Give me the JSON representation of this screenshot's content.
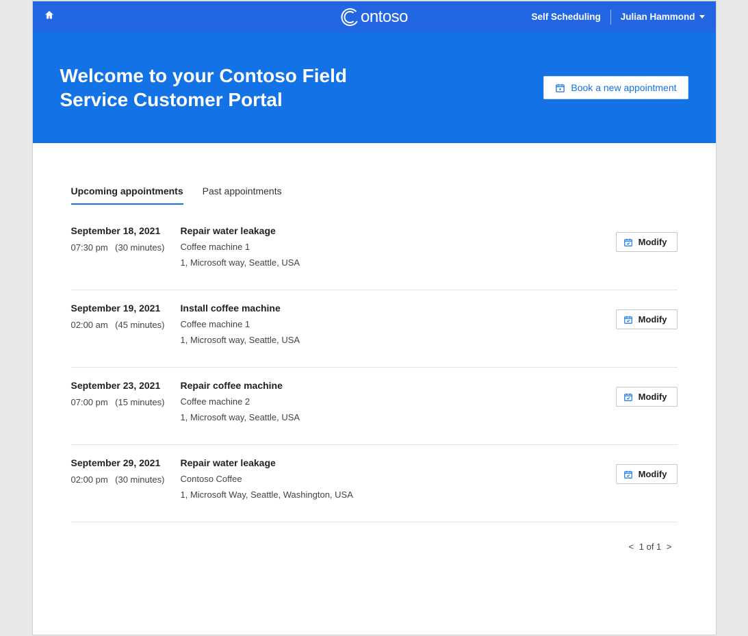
{
  "nav": {
    "brand": "ontoso",
    "self_scheduling": "Self Scheduling",
    "user_name": "Julian Hammond"
  },
  "hero": {
    "title": "Welcome to your Contoso Field Service Customer Portal",
    "book_label": "Book a new appointment"
  },
  "tabs": {
    "upcoming": "Upcoming appointments",
    "past": "Past appointments"
  },
  "appointments": [
    {
      "date": "September 18, 2021",
      "time": "07:30 pm",
      "duration": "(30 minutes)",
      "title": "Repair water leakage",
      "asset": "Coffee machine 1",
      "address": "1, Microsoft way, Seattle, USA",
      "action": "Modify"
    },
    {
      "date": "September 19, 2021",
      "time": "02:00 am",
      "duration": "(45 minutes)",
      "title": "Install coffee machine",
      "asset": "Coffee machine 1",
      "address": "1, Microsoft way, Seattle, USA",
      "action": "Modify"
    },
    {
      "date": "September 23, 2021",
      "time": "07:00 pm",
      "duration": "(15 minutes)",
      "title": "Repair coffee machine",
      "asset": "Coffee machine 2",
      "address": "1, Microsoft way, Seattle, USA",
      "action": "Modify"
    },
    {
      "date": "September 29, 2021",
      "time": "02:00 pm",
      "duration": "(30 minutes)",
      "title": "Repair water leakage",
      "asset": "Contoso Coffee",
      "address": "1, Microsoft Way, Seattle, Washington, USA",
      "action": "Modify"
    }
  ],
  "pagination": {
    "prev": "<",
    "text": "1 of 1",
    "next": ">"
  }
}
